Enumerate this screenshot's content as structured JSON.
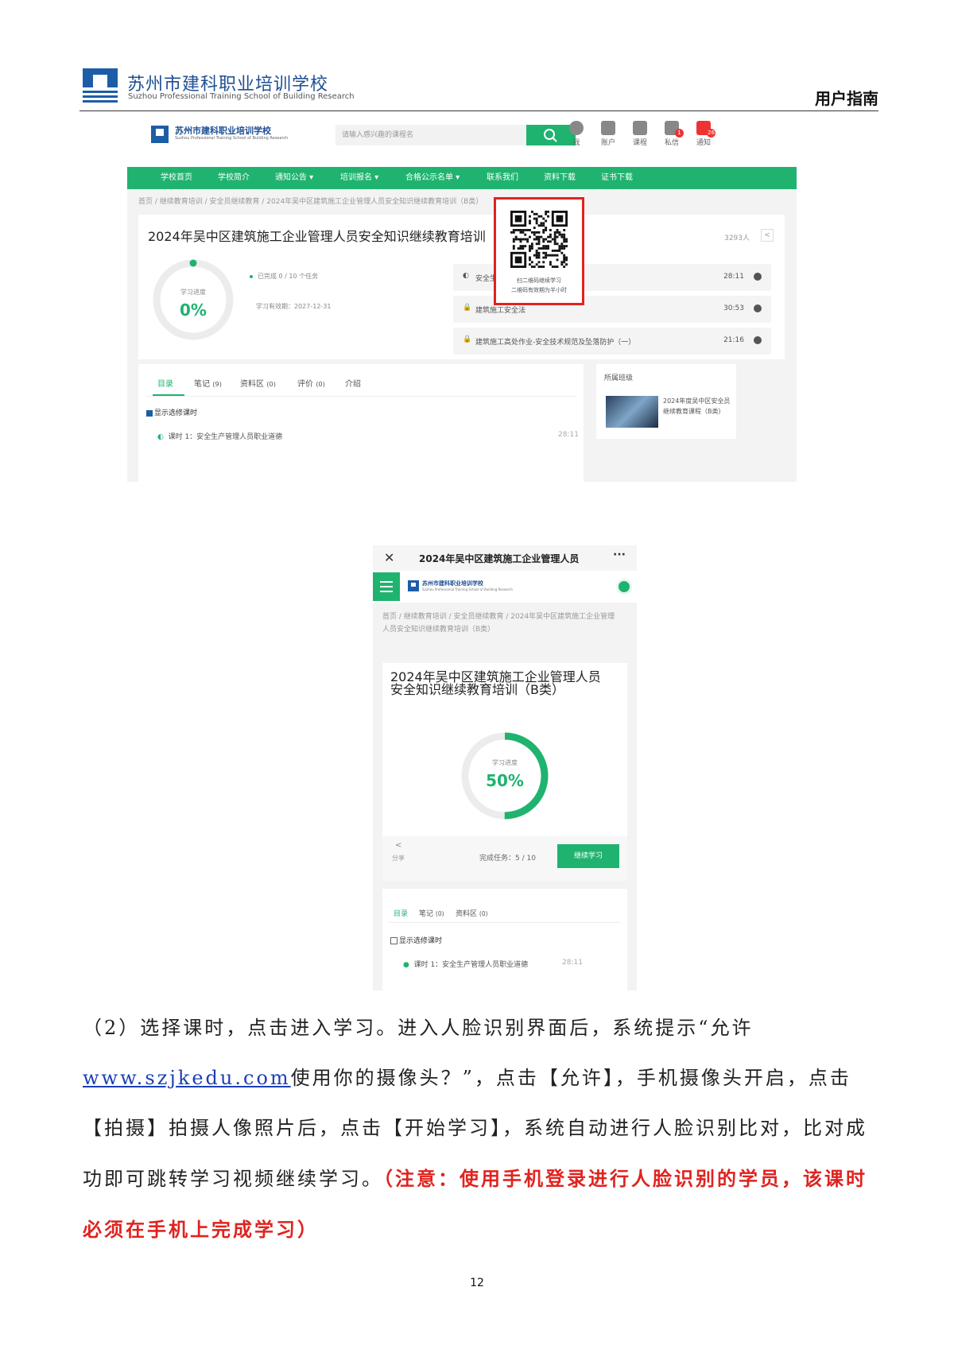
{
  "header": {
    "school_name_cn": "苏州市建科职业培训学校",
    "school_name_en": "Suzhou Professional Training School of Building Research",
    "guide_title": "用户指南"
  },
  "desktop": {
    "logo_name_cn": "苏州市建科职业培训学校",
    "logo_name_en": "Suzhou Professional Training School of Building Research",
    "search_placeholder": "请输入感兴趣的课程名",
    "top_icons": [
      {
        "label": "我",
        "icon": "avatar-icon"
      },
      {
        "label": "账户",
        "icon": "account-icon"
      },
      {
        "label": "课程",
        "icon": "book-icon"
      },
      {
        "label": "私信",
        "icon": "mail-icon",
        "badge": "1"
      },
      {
        "label": "通知",
        "icon": "bell-icon",
        "badge": "26"
      }
    ],
    "nav": [
      "学校首页",
      "学校简介",
      "通知公告 ▾",
      "培训报名 ▾",
      "合格公示名单 ▾",
      "联系我们",
      "资料下载",
      "证书下载"
    ],
    "breadcrumb": "首页 / 继续教育培训 / 安全员继续教育 / 2024年吴中区建筑施工企业管理人员安全知识继续教育培训（B类）",
    "course_title": "2024年吴中区建筑施工企业管理人员安全知识继续教育培训（B类）",
    "learners": "3293人",
    "progress_label": "学习进度",
    "progress_value": "0%",
    "progress_fraction": 0,
    "tasks_done": "已完成 0 / 10 个任务",
    "valid_until": "学习有效期：2027-12-31",
    "lessons": [
      {
        "icon": "◐",
        "name": "安全生产管理人",
        "time": "28:11"
      },
      {
        "icon": "🔒",
        "name": "建筑施工安全法",
        "time": "30:53"
      },
      {
        "icon": "🔒",
        "name": "建筑施工高处作业-安全技术规范及坠落防护（一）",
        "time": "21:16"
      }
    ],
    "qr_line1": "扫二维码继续学习",
    "qr_line2": "二维码有效期为半小时",
    "tabs": [
      {
        "label": "目录",
        "count": ""
      },
      {
        "label": "笔记",
        "count": "(9)"
      },
      {
        "label": "资料区",
        "count": "(0)"
      },
      {
        "label": "评价",
        "count": "(0)"
      },
      {
        "label": "介绍",
        "count": ""
      }
    ],
    "show_optional": "显示选修课时",
    "first_lesson": "课时 1：安全生产管理人员职业道德",
    "first_lesson_time": "28:11",
    "side_title": "所属班级",
    "side_class": "2024年度吴中区安全员继续教育课程（B类）"
  },
  "mobile": {
    "title": "2024年吴中区建筑施工企业管理人员",
    "close": "✕",
    "more": "···",
    "logo_name_cn": "苏州市建科职业培训学校",
    "logo_name_en": "Suzhou Professional Training School of Building Research",
    "breadcrumb": "首页 / 继续教育培训 / 安全员继续教育 / 2024年吴中区建筑施工企业管理人员安全知识继续教育培训（B类）",
    "course_title": "2024年吴中区建筑施工企业管理人员安全知识继续教育培训（B类）",
    "progress_label": "学习进度",
    "progress_value": "50%",
    "progress_fraction": 0.5,
    "share_label": "分享",
    "tasks_done": "完成任务：5 / 10",
    "continue_button": "继续学习",
    "tabs": [
      {
        "label": "目录",
        "count": ""
      },
      {
        "label": "笔记",
        "count": "(0)"
      },
      {
        "label": "资料区",
        "count": "(0)"
      }
    ],
    "show_optional": "显示选修课时",
    "first_lesson": "课时 1：安全生产管理人员职业道德",
    "first_lesson_time": "28:11"
  },
  "body": {
    "part1": "（2）选择课时，点击进入学习。进入人脸识别界面后，系统提示“允许",
    "link": "www.szjkedu.com",
    "part2": "使用你的摄像头？”，点击【允许】，手机摄像头开启，点击【拍摄】拍摄人像照片后，点击【开始学习】，系统自动进行人脸识别比对，比对成功即可跳转学习视频继续学习。",
    "warning": "（注意：使用手机登录进行人脸识别的学员，该课时必须在手机上完成学习）"
  },
  "page_number": "12",
  "colors": {
    "brand_green": "#1fb36f",
    "brand_blue": "#1d5da8",
    "warning_red": "#e0231f"
  }
}
